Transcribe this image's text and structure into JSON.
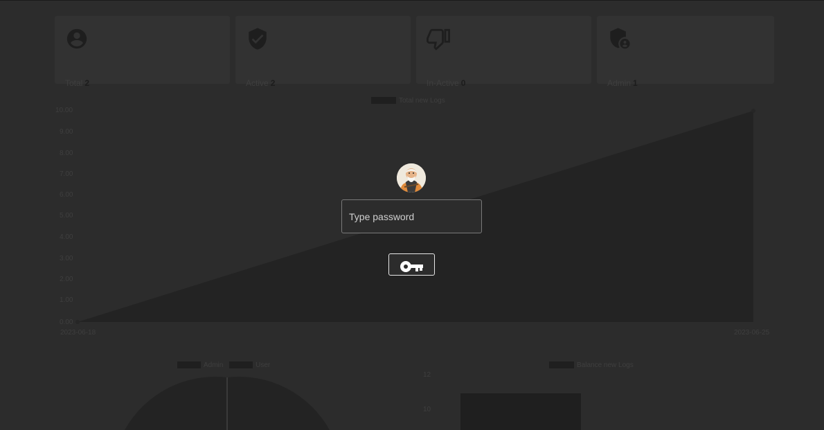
{
  "stats": [
    {
      "label": "Total",
      "value": "2",
      "icon": "account-circle-icon"
    },
    {
      "label": "Active",
      "value": "2",
      "icon": "verified-shield-icon"
    },
    {
      "label": "In-Active",
      "value": "0",
      "icon": "thumb-down-icon"
    },
    {
      "label": "Admin",
      "value": "1",
      "icon": "admin-shield-icon"
    }
  ],
  "line_chart": {
    "legend": "Total new Logs",
    "y_ticks": [
      "10.00",
      "9.00",
      "8.00",
      "7.00",
      "6.00",
      "5.00",
      "4.00",
      "3.00",
      "2.00",
      "1.00",
      "0.00"
    ],
    "x_ticks": [
      "2023-06-18",
      "2023-06-25"
    ]
  },
  "pie_chart": {
    "legends": [
      "Admin",
      "User"
    ]
  },
  "bar_chart": {
    "legend": "Balance new Logs",
    "y_ticks": [
      "12",
      "10"
    ]
  },
  "login": {
    "password_placeholder": "Type password",
    "submit_icon": "key-icon"
  },
  "chart_data": [
    {
      "type": "area",
      "x": [
        "2023-06-18",
        "2023-06-25"
      ],
      "series": [
        {
          "name": "Total new Logs",
          "values": [
            0,
            10
          ]
        }
      ],
      "ylim": [
        0,
        10
      ]
    }
  ]
}
